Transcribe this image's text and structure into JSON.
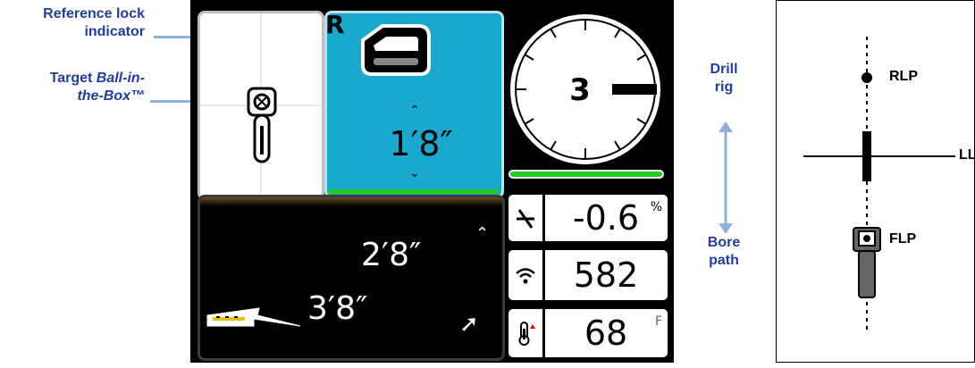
{
  "annotations": {
    "reference_lock_line1": "Reference lock",
    "reference_lock_line2": "indicator",
    "target_line1_plain": "Target ",
    "target_line1_italic": "Ball-in-",
    "target_line2": "the-Box™",
    "drill_rig_line1": "Drill",
    "drill_rig_line2": "rig",
    "bore_path_line1": "Bore",
    "bore_path_line2": "path"
  },
  "display": {
    "reference_lock_letter": "R",
    "depth_top": "1′8″",
    "depth_mid": "2′8″",
    "depth_bottom": "3′8″",
    "roll_value": "3",
    "pitch_value": "-0.6",
    "pitch_unit": "%",
    "signal_value": "582",
    "temp_value": "68",
    "temp_unit": "F"
  },
  "locate_diagram": {
    "rlp_label": "RLP",
    "ll_label": "LL",
    "flp_label": "FLP"
  },
  "colors": {
    "annotation_text": "#1f3ea0",
    "arrow": "#8fb0dd",
    "depth_panel": "#19a9cc",
    "signal_bar": "#22cc22",
    "transmitter_gray": "#666666"
  },
  "icons": [
    "locator-icon",
    "transmitter-icon",
    "pitch-icon",
    "signal-icon",
    "temperature-icon",
    "drill-head-icon",
    "depth-arrow-icon"
  ]
}
